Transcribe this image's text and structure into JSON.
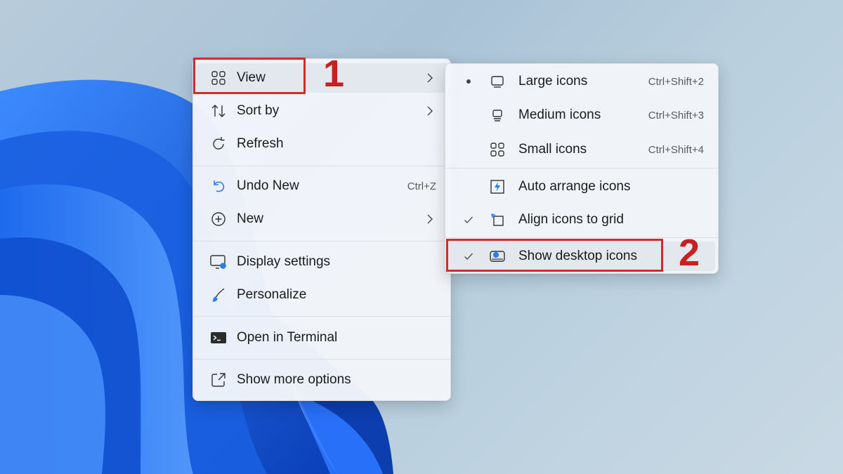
{
  "context_menu": {
    "items": [
      {
        "label": "View",
        "icon": "view-grid-icon",
        "has_submenu": true
      },
      {
        "label": "Sort by",
        "icon": "sort-icon",
        "has_submenu": true
      },
      {
        "label": "Refresh",
        "icon": "refresh-icon"
      },
      {
        "label": "Undo New",
        "icon": "undo-icon",
        "shortcut": "Ctrl+Z"
      },
      {
        "label": "New",
        "icon": "new-plus-icon",
        "has_submenu": true
      },
      {
        "label": "Display settings",
        "icon": "display-settings-icon"
      },
      {
        "label": "Personalize",
        "icon": "personalize-brush-icon"
      },
      {
        "label": "Open in Terminal",
        "icon": "terminal-icon"
      },
      {
        "label": "Show more options",
        "icon": "show-more-icon"
      }
    ]
  },
  "view_submenu": {
    "items": [
      {
        "label": "Large icons",
        "shortcut": "Ctrl+Shift+2",
        "state": "selected-bullet",
        "icon": "large-icons-icon"
      },
      {
        "label": "Medium icons",
        "shortcut": "Ctrl+Shift+3",
        "state": "",
        "icon": "medium-icons-icon"
      },
      {
        "label": "Small icons",
        "shortcut": "Ctrl+Shift+4",
        "state": "",
        "icon": "small-icons-icon"
      },
      {
        "label": "Auto arrange icons",
        "state": "",
        "icon": "auto-arrange-icon"
      },
      {
        "label": "Align icons to grid",
        "state": "checked",
        "icon": "align-grid-icon"
      },
      {
        "label": "Show desktop icons",
        "state": "checked",
        "icon": "show-desktop-icons-icon"
      }
    ]
  },
  "annotations": {
    "step1": "1",
    "step2": "2"
  },
  "colors": {
    "highlight_red": "#d42a2a",
    "wallpaper_blue": "#1565e0",
    "menu_bg": "#f2f5fa"
  }
}
